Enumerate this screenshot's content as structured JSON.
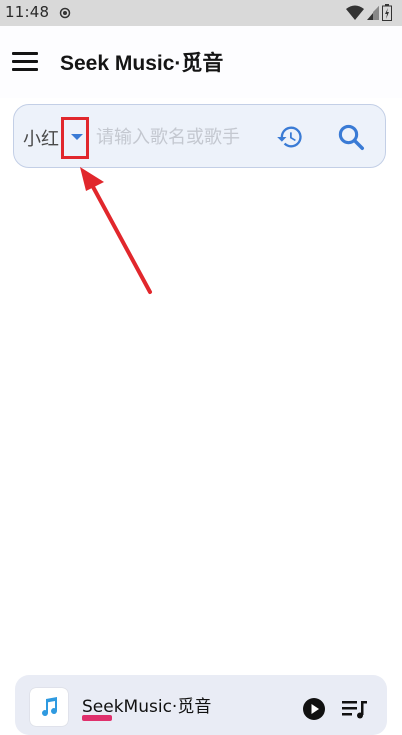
{
  "status_bar": {
    "time": "11:48",
    "icons": [
      "sync-icon",
      "wifi-icon",
      "signal-icon",
      "battery-icon"
    ]
  },
  "app_bar": {
    "title": "Seek Music·觅音",
    "menu_icon": "menu-icon"
  },
  "search": {
    "source_label": "小红",
    "dropdown_icon": "caret-down-icon",
    "placeholder": "请输入歌名或歌手",
    "history_icon": "history-icon",
    "search_icon": "search-icon",
    "accent_color": "#3a7bd5"
  },
  "annotation": {
    "highlight_color": "#e1272c"
  },
  "player": {
    "title": "SeekMusic·觅音",
    "art_icon": "music-note-icon",
    "play_icon": "play-icon",
    "queue_icon": "queue-music-icon"
  }
}
